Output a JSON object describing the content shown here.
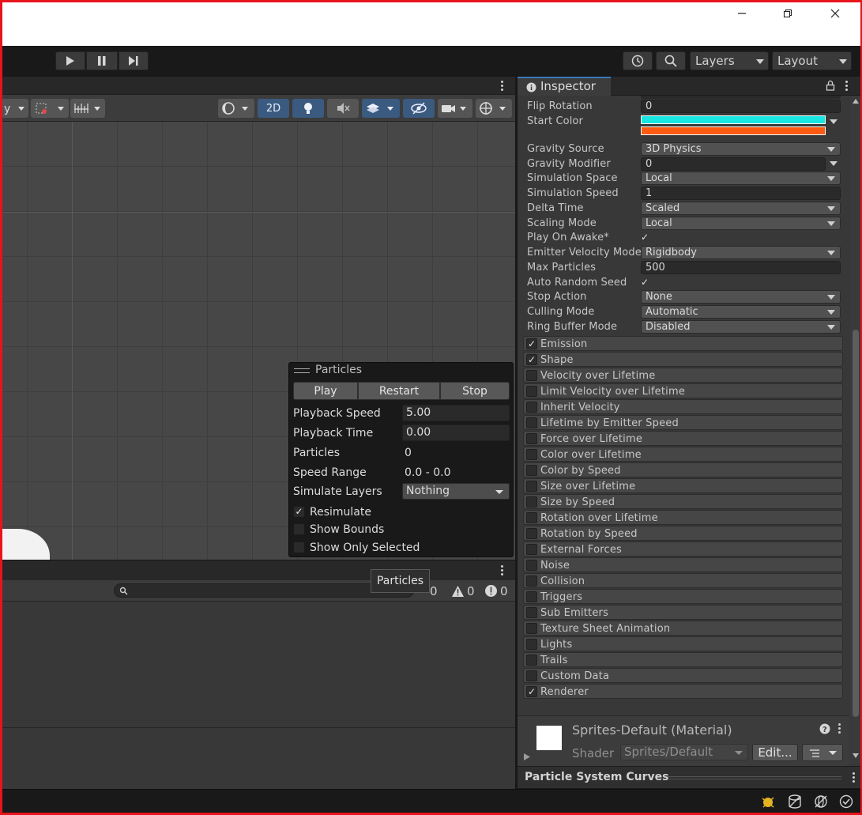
{
  "toolbar": {
    "layers_label": "Layers",
    "layout_label": "Layout"
  },
  "scene": {
    "tools": {
      "mode_2d_label": "2D"
    }
  },
  "particles_overlay": {
    "title": "Particles",
    "buttons": {
      "play": "Play",
      "restart": "Restart",
      "stop": "Stop"
    },
    "playback_speed": {
      "label": "Playback Speed",
      "value": "5.00"
    },
    "playback_time": {
      "label": "Playback Time",
      "value": "0.00"
    },
    "particles": {
      "label": "Particles",
      "value": "0"
    },
    "speed_range": {
      "label": "Speed Range",
      "value": "0.0 - 0.0"
    },
    "simulate_layers": {
      "label": "Simulate Layers",
      "value": "Nothing"
    },
    "resimulate": {
      "label": "Resimulate",
      "checked": "✓"
    },
    "show_bounds": {
      "label": "Show Bounds"
    },
    "show_only_selected": {
      "label": "Show Only Selected"
    }
  },
  "console": {
    "tooltip": "Particles",
    "log_count": "0",
    "warning_count": "0",
    "error_count": "0"
  },
  "inspector": {
    "tab_label": "Inspector",
    "props": {
      "flip_rotation": {
        "label": "Flip Rotation",
        "value": "0"
      },
      "start_color": {
        "label": "Start Color",
        "color_a": "#17e6e2",
        "color_b": "#ff5a12"
      },
      "gravity_source": {
        "label": "Gravity Source",
        "value": "3D Physics"
      },
      "gravity_modifier": {
        "label": "Gravity Modifier",
        "value": "0"
      },
      "simulation_space": {
        "label": "Simulation Space",
        "value": "Local"
      },
      "simulation_speed": {
        "label": "Simulation Speed",
        "value": "1"
      },
      "delta_time": {
        "label": "Delta Time",
        "value": "Scaled"
      },
      "scaling_mode": {
        "label": "Scaling Mode",
        "value": "Local"
      },
      "play_on_awake": {
        "label": "Play On Awake*",
        "checked": "✓"
      },
      "emitter_velocity_mode": {
        "label": "Emitter Velocity Mode",
        "value": "Rigidbody"
      },
      "max_particles": {
        "label": "Max Particles",
        "value": "500"
      },
      "auto_random_seed": {
        "label": "Auto Random Seed",
        "checked": "✓"
      },
      "stop_action": {
        "label": "Stop Action",
        "value": "None"
      },
      "culling_mode": {
        "label": "Culling Mode",
        "value": "Automatic"
      },
      "ring_buffer_mode": {
        "label": "Ring Buffer Mode",
        "value": "Disabled"
      }
    },
    "modules": [
      {
        "label": "Emission",
        "check": "✓"
      },
      {
        "label": "Shape",
        "check": "✓"
      },
      {
        "label": "Velocity over Lifetime",
        "check": ""
      },
      {
        "label": "Limit Velocity over Lifetime",
        "check": ""
      },
      {
        "label": "Inherit Velocity",
        "check": ""
      },
      {
        "label": "Lifetime by Emitter Speed",
        "check": ""
      },
      {
        "label": "Force over Lifetime",
        "check": ""
      },
      {
        "label": "Color over Lifetime",
        "check": ""
      },
      {
        "label": "Color by Speed",
        "check": ""
      },
      {
        "label": "Size over Lifetime",
        "check": ""
      },
      {
        "label": "Size by Speed",
        "check": ""
      },
      {
        "label": "Rotation over Lifetime",
        "check": ""
      },
      {
        "label": "Rotation by Speed",
        "check": ""
      },
      {
        "label": "External Forces",
        "check": ""
      },
      {
        "label": "Noise",
        "check": ""
      },
      {
        "label": "Collision",
        "check": ""
      },
      {
        "label": "Triggers",
        "check": ""
      },
      {
        "label": "Sub Emitters",
        "check": ""
      },
      {
        "label": "Texture Sheet Animation",
        "check": ""
      },
      {
        "label": "Lights",
        "check": ""
      },
      {
        "label": "Trails",
        "check": ""
      },
      {
        "label": "Custom Data",
        "check": ""
      },
      {
        "label": "Renderer",
        "check": "✓"
      }
    ],
    "material": {
      "name": "Sprites-Default (Material)",
      "shader_label": "Shader",
      "shader_value": "Sprites/Default",
      "edit_label": "Edit..."
    },
    "curves_label": "Particle System Curves"
  }
}
